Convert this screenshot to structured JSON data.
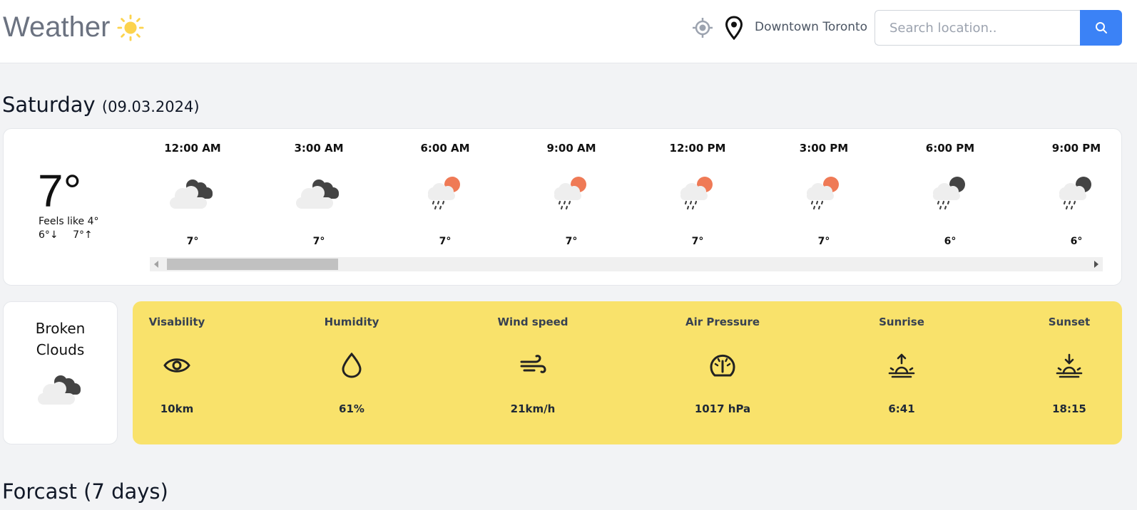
{
  "header": {
    "title": "Weather",
    "location": "Downtown Toronto",
    "search_placeholder": "Search location.."
  },
  "today": {
    "day": "Saturday",
    "date": "(09.03.2024)",
    "temp": "7°",
    "feels_like": "Feels like 4°",
    "min": "6°↓",
    "max": "7°↑",
    "condition_line1": "Broken",
    "condition_line2": "Clouds"
  },
  "hourly": [
    {
      "time": "12:00 AM",
      "icon": "broken-clouds-icon",
      "temp": "7°"
    },
    {
      "time": "3:00 AM",
      "icon": "broken-clouds-icon",
      "temp": "7°"
    },
    {
      "time": "6:00 AM",
      "icon": "rain-day-icon",
      "temp": "7°"
    },
    {
      "time": "9:00 AM",
      "icon": "rain-day-icon",
      "temp": "7°"
    },
    {
      "time": "12:00 PM",
      "icon": "rain-day-icon",
      "temp": "7°"
    },
    {
      "time": "3:00 PM",
      "icon": "rain-day-icon",
      "temp": "7°"
    },
    {
      "time": "6:00 PM",
      "icon": "rain-night-icon",
      "temp": "6°"
    },
    {
      "time": "9:00 PM",
      "icon": "rain-night-icon",
      "temp": "6°"
    }
  ],
  "details": [
    {
      "label": "Visability",
      "icon": "eye-icon",
      "value": "10km"
    },
    {
      "label": "Humidity",
      "icon": "droplet-icon",
      "value": "61%"
    },
    {
      "label": "Wind speed",
      "icon": "wind-icon",
      "value": "21km/h"
    },
    {
      "label": "Air Pressure",
      "icon": "gauge-icon",
      "value": "1017 hPa"
    },
    {
      "label": "Sunrise",
      "icon": "sunrise-icon",
      "value": "6:41"
    },
    {
      "label": "Sunset",
      "icon": "sunset-icon",
      "value": "18:15"
    }
  ],
  "forecast": {
    "title": "Forcast (7 days)"
  },
  "colors": {
    "accent": "#3b82f6",
    "details_bg": "#f9e26b",
    "sun": "#fcd34d",
    "sun_icon": "#ef7a56"
  }
}
